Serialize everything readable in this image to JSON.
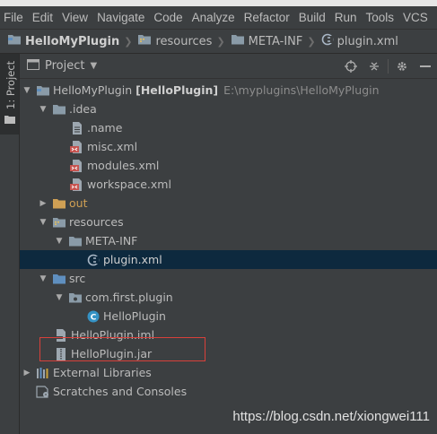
{
  "menubar": [
    "File",
    "Edit",
    "View",
    "Navigate",
    "Code",
    "Analyze",
    "Refactor",
    "Build",
    "Run",
    "Tools",
    "VCS"
  ],
  "navbar": {
    "project": "HelloMyPlugin",
    "folder1": "resources",
    "folder2": "META-INF",
    "file": "plugin.xml"
  },
  "sidebar": {
    "tab_label": "1: Project"
  },
  "panel": {
    "title": "Project"
  },
  "tree": {
    "root_name": "HelloMyPlugin",
    "root_module": "[HelloPlugin]",
    "root_path": "E:\\myplugins\\HelloMyPlugin",
    "idea": ".idea",
    "name_file": ".name",
    "misc": "misc.xml",
    "modules": "modules.xml",
    "workspace": "workspace.xml",
    "out": "out",
    "resources": "resources",
    "meta_inf": "META-INF",
    "plugin_xml": "plugin.xml",
    "src": "src",
    "package": "com.first.plugin",
    "class": "HelloPlugin",
    "iml": "HelloPlugin.iml",
    "jar": "HelloPlugin.jar",
    "ext_libs": "External Libraries",
    "scratches": "Scratches and Consoles"
  },
  "colors": {
    "background": "#3c3f41",
    "selection": "#0d293e",
    "highlight_box": "#d9403a",
    "folder": "#8a9ba8",
    "excluded_folder": "#d0a054",
    "source_folder": "#5f8fbf"
  },
  "watermark": "https://blog.csdn.net/xiongwei111"
}
